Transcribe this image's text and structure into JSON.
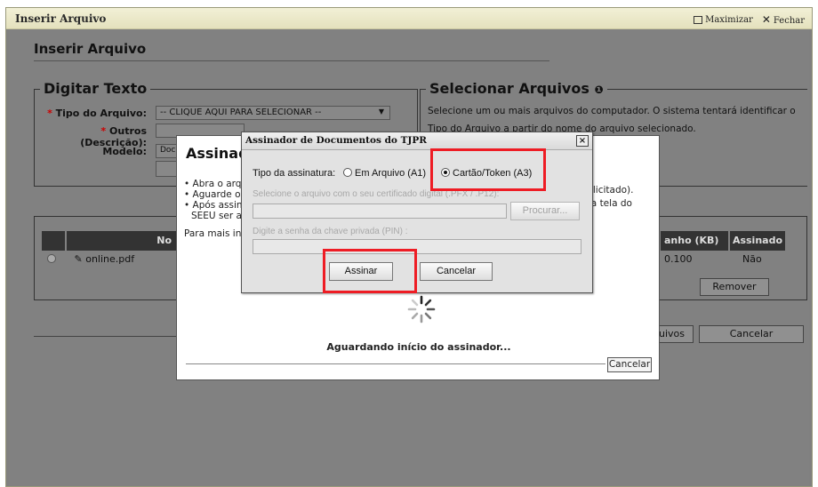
{
  "window": {
    "title": "Inserir Arquivo",
    "maximize_label": "Maximizar",
    "close_label": "Fechar"
  },
  "page": {
    "title": "Inserir Arquivo"
  },
  "digitar_texto": {
    "legend": "Digitar Texto",
    "tipo_label": "Tipo do Arquivo:",
    "tipo_value": "-- CLIQUE AQUI PARA SELECIONAR --",
    "outros_label": "Outros (Descrição):",
    "modelo_label": "Modelo:",
    "modelo_value": "Doc"
  },
  "selecionar_arquivos": {
    "legend": "Selecionar Arquivos",
    "line1": "Selecione um ou mais arquivos do computador. O sistema tentará identificar o",
    "line2": "Tipo do Arquivo a partir do nome do arquivo selecionado."
  },
  "table": {
    "col_nome": "No",
    "col_tamanho": "anho (KB)",
    "col_assinado": "Assinado",
    "rows": [
      {
        "name": "online.pdf",
        "size": "0.100",
        "signed": "Não"
      }
    ],
    "remove_label": "Remover"
  },
  "footer": {
    "arquivos_label": "uivos",
    "cancel_label": "Cancelar"
  },
  "modal": {
    "title": "Assinad",
    "bullets": [
      "Abra o arqu",
      "Aguarde o",
      "Após assina",
      "SEEU ser a"
    ],
    "more_info": "Para mais inf",
    "right_line1": "solicitado).",
    "right_line2": "e a tela do",
    "waiting": "Aguardando início do assinador...",
    "cancel_label": "Cancelar"
  },
  "signer": {
    "title": "Assinador de Documentos do TJPR",
    "close_glyph": "×",
    "tipo_label": "Tipo da assinatura:",
    "option_a1": "Em Arquivo (A1)",
    "option_a3": "Cartão/Token (A3)",
    "selected": "A3",
    "cert_label": "Selecione o arquivo com o seu certificado digital (.PFX / .P12):",
    "browse_label": "Procurar...",
    "pin_label": "Digite a senha da chave privada (PIN) :",
    "sign_label": "Assinar",
    "cancel_label": "Cancelar"
  },
  "colors": {
    "highlight": "#ee1c24",
    "overlay": "#818181"
  }
}
